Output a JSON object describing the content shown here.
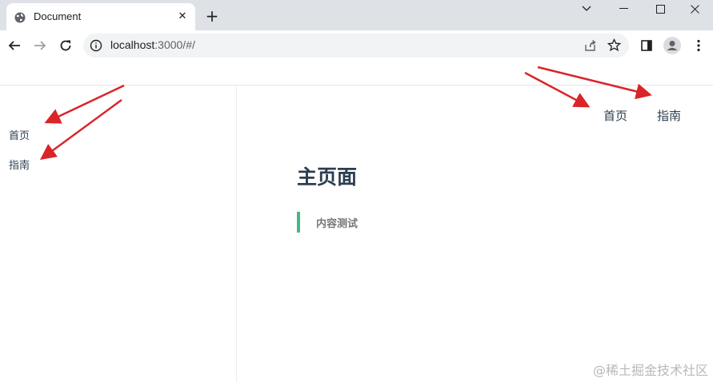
{
  "browser": {
    "tab": {
      "title": "Document",
      "close_glyph": "✕",
      "favicon": "globe-icon"
    },
    "new_tab_glyph": "+",
    "url_host": "localhost",
    "url_rest": ":3000/#/",
    "icons": [
      "back-icon",
      "forward-icon",
      "reload-icon",
      "info-icon",
      "share-icon",
      "star-icon",
      "sidepanel-icon",
      "profile-icon",
      "menu-icon"
    ]
  },
  "sidebar": {
    "items": [
      {
        "label": "首页"
      },
      {
        "label": "指南"
      }
    ]
  },
  "nav": {
    "items": [
      {
        "label": "首页"
      },
      {
        "label": "指南"
      }
    ]
  },
  "main": {
    "title": "主页面",
    "blockquote": "内容测试"
  },
  "watermark": "@稀土掘金技术社区",
  "colors": {
    "accent": "#42b983",
    "text": "#2c3e50",
    "annotation_arrow": "#d9252a"
  }
}
